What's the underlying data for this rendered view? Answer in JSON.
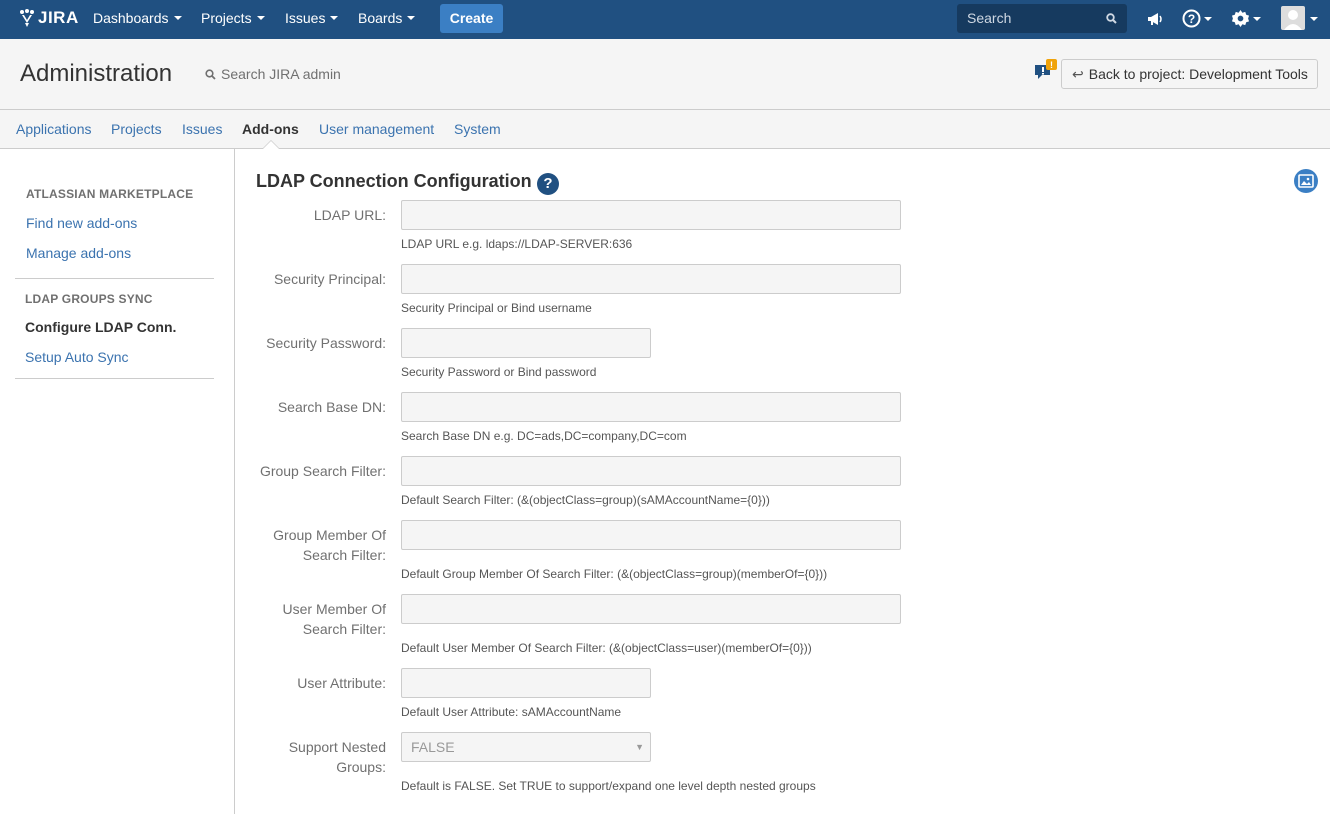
{
  "topnav": {
    "logo": "JIRA",
    "menus": [
      "Dashboards",
      "Projects",
      "Issues",
      "Boards"
    ],
    "create_label": "Create",
    "search_placeholder": "Search"
  },
  "header": {
    "title": "Administration",
    "search_label": "Search JIRA admin",
    "back_label": "Back to project: Development Tools",
    "feedback_badge": "!"
  },
  "tabs": [
    "Applications",
    "Projects",
    "Issues",
    "Add-ons",
    "User management",
    "System"
  ],
  "active_tab": "Add-ons",
  "sidebar": {
    "sections": [
      {
        "heading": "ATLASSIAN MARKETPLACE",
        "items": [
          "Find new add-ons",
          "Manage add-ons"
        ]
      },
      {
        "heading": "LDAP GROUPS SYNC",
        "items": [
          "Configure LDAP Conn.",
          "Setup Auto Sync"
        ]
      }
    ],
    "current_item": "Configure LDAP Conn."
  },
  "main": {
    "title": "LDAP Connection Configuration",
    "help_glyph": "?",
    "fields": [
      {
        "label": "LDAP URL:",
        "value": "",
        "description": "LDAP URL e.g. ldaps://LDAP-SERVER:636"
      },
      {
        "label": "Security Principal:",
        "value": "",
        "description": "Security Principal or Bind username"
      },
      {
        "label": "Security Password:",
        "value": "",
        "description": "Security Password or Bind password"
      },
      {
        "label": "Search Base DN:",
        "value": "",
        "description": "Search Base DN e.g. DC=ads,DC=company,DC=com"
      },
      {
        "label": "Group Search Filter:",
        "value": "",
        "description": "Default Search Filter: (&(objectClass=group)(sAMAccountName={0}))"
      },
      {
        "label_line1": "Group Member Of",
        "label_line2": "Search Filter:",
        "value": "",
        "description": "Default Group Member Of Search Filter: (&(objectClass=group)(memberOf={0}))"
      },
      {
        "label_line1": "User Member Of",
        "label_line2": "Search Filter:",
        "value": "",
        "description": "Default User Member Of Search Filter: (&(objectClass=user)(memberOf={0}))"
      },
      {
        "label": "User Attribute:",
        "value": "",
        "description": "Default User Attribute: sAMAccountName"
      },
      {
        "label_line1": "Support Nested",
        "label_line2": "Groups:",
        "value": "FALSE",
        "description": "Default is FALSE. Set TRUE to support/expand one level depth nested groups"
      }
    ]
  },
  "colors": {
    "nav": "#205081",
    "link": "#3b73af",
    "create": "#3b7fc4"
  },
  "icons": [
    "jira-logo-icon",
    "search-icon",
    "megaphone-icon",
    "help-icon",
    "gear-icon",
    "avatar-icon",
    "feedback-icon",
    "back-arrow-icon",
    "dropdown-icon",
    "sidebar-toggle-icon"
  ]
}
